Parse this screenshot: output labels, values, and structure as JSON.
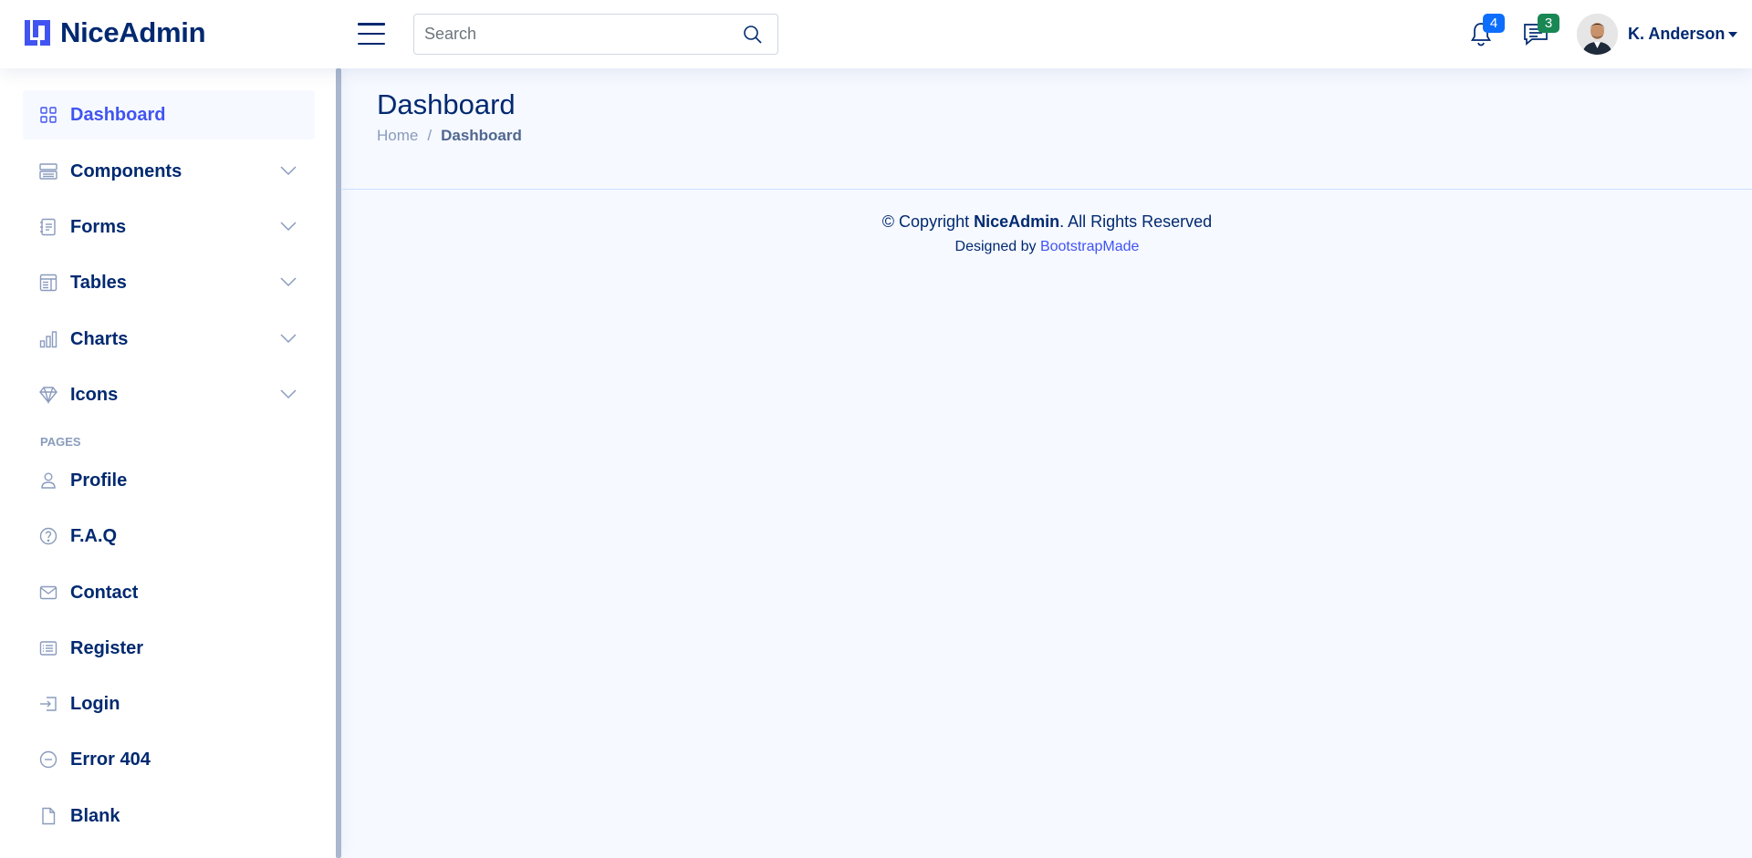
{
  "header": {
    "brand": "NiceAdmin",
    "search_placeholder": "Search",
    "notifications_count": "4",
    "messages_count": "3",
    "user_name": "K. Anderson"
  },
  "sidebar": {
    "items": [
      {
        "label": "Dashboard",
        "icon": "grid-icon",
        "active": true
      },
      {
        "label": "Components",
        "icon": "menu-button-icon",
        "expandable": true
      },
      {
        "label": "Forms",
        "icon": "journal-text-icon",
        "expandable": true
      },
      {
        "label": "Tables",
        "icon": "layout-text-window-icon",
        "expandable": true
      },
      {
        "label": "Charts",
        "icon": "bar-chart-icon",
        "expandable": true
      },
      {
        "label": "Icons",
        "icon": "gem-icon",
        "expandable": true
      }
    ],
    "pages_heading": "Pages",
    "pages": [
      {
        "label": "Profile",
        "icon": "person-icon"
      },
      {
        "label": "F.A.Q",
        "icon": "question-circle-icon"
      },
      {
        "label": "Contact",
        "icon": "envelope-icon"
      },
      {
        "label": "Register",
        "icon": "card-list-icon"
      },
      {
        "label": "Login",
        "icon": "box-arrow-in-right-icon"
      },
      {
        "label": "Error 404",
        "icon": "dash-circle-icon"
      },
      {
        "label": "Blank",
        "icon": "file-icon"
      }
    ]
  },
  "main": {
    "title": "Dashboard",
    "breadcrumb": {
      "home": "Home",
      "separator": "/",
      "current": "Dashboard"
    }
  },
  "footer": {
    "copyright_prefix": "© Copyright ",
    "copyright_brand": "NiceAdmin",
    "copyright_suffix": ". All Rights Reserved",
    "designed_by": "Designed by ",
    "designer": "BootstrapMade"
  },
  "colors": {
    "primary": "#4154f1",
    "text": "#012970",
    "background": "#f6f9ff",
    "badge_notifications": "#0d6efd",
    "badge_messages": "#198754"
  }
}
